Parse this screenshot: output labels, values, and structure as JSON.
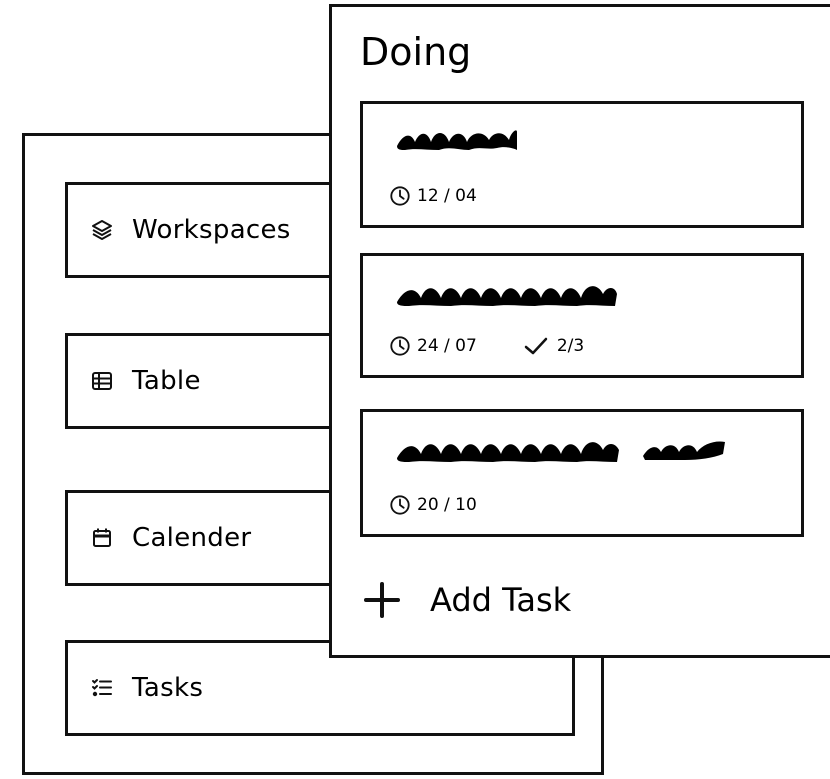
{
  "sidebar": {
    "items": [
      {
        "label": "Workspaces",
        "icon": "layers-icon"
      },
      {
        "label": "Table",
        "icon": "table-icon"
      },
      {
        "label": "Calender",
        "icon": "calendar-icon"
      },
      {
        "label": "Tasks",
        "icon": "checklist-icon"
      }
    ]
  },
  "doing": {
    "title": "Doing",
    "tasks": [
      {
        "date": "12 / 04"
      },
      {
        "date": "24 / 07",
        "progress": "2/3"
      },
      {
        "date": "20 / 10"
      }
    ],
    "add_label": "Add Task"
  }
}
